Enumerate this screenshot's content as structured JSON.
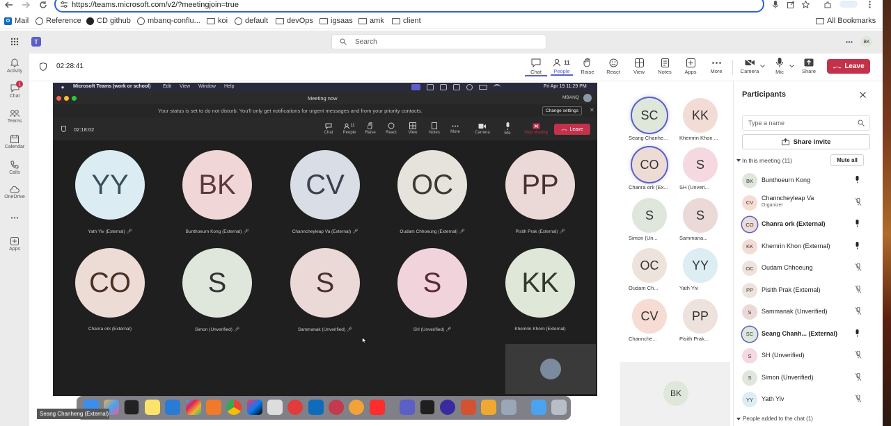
{
  "browser": {
    "url": "https://teams.microsoft.com/v2/?meetingjoin=true",
    "bookmarks": [
      "Mail",
      "Reference",
      "CD github",
      "mbanq-conflu...",
      "koi",
      "default",
      "devOps",
      "igsaas",
      "amk",
      "client"
    ],
    "all_bookmarks": "All Bookmarks"
  },
  "teams": {
    "search_placeholder": "Search",
    "avatar_initials": "BK",
    "rail": [
      {
        "label": "Activity",
        "icon": "bell-icon"
      },
      {
        "label": "Chat",
        "icon": "chat-icon",
        "badge": "1"
      },
      {
        "label": "Teams",
        "icon": "teams-icon"
      },
      {
        "label": "Calendar",
        "icon": "calendar-icon"
      },
      {
        "label": "Calls",
        "icon": "phone-icon"
      },
      {
        "label": "OneDrive",
        "icon": "cloud-icon"
      },
      {
        "label": "Apps",
        "icon": "apps-icon"
      }
    ]
  },
  "meeting": {
    "timer": "02:28:41",
    "tools": [
      {
        "label": "Chat",
        "icon": "chat-icon"
      },
      {
        "label": "People",
        "icon": "people-icon",
        "count": "11"
      },
      {
        "label": "Raise",
        "icon": "hand-icon"
      },
      {
        "label": "React",
        "icon": "smile-icon"
      },
      {
        "label": "View",
        "icon": "grid-icon"
      },
      {
        "label": "Notes",
        "icon": "notes-icon"
      },
      {
        "label": "Apps",
        "icon": "plus-icon"
      },
      {
        "label": "More",
        "icon": "more-icon"
      },
      {
        "label": "Camera",
        "icon": "camera-icon"
      },
      {
        "label": "Mic",
        "icon": "mic-icon"
      },
      {
        "label": "Share",
        "icon": "share-icon"
      }
    ],
    "leave": "Leave"
  },
  "shared": {
    "menubar": [
      "Microsoft Teams (work or school)",
      "Edit",
      "View",
      "Window",
      "Help"
    ],
    "clock": "Fri Apr 19  11:29 PM",
    "window_title": "Meeting now",
    "org": "MBANQ",
    "dnd": "Your status is set to do not disturb. You'll only get notifications for urgent messages and from your priority contacts.",
    "change_settings": "Change settings",
    "timer": "02:18:02",
    "tools": [
      "Chat",
      "People",
      "Raise",
      "React",
      "View",
      "Notes",
      "More",
      "Camera",
      "Mic",
      "Stop sharing"
    ],
    "people_count": "11",
    "leave": "Leave",
    "tiles": [
      {
        "initials": "YY",
        "name": "Yath Yiv (External)",
        "bg": "#dcecf3"
      },
      {
        "initials": "BK",
        "name": "Bunthoeurn Kong (External)",
        "bg": "#f0d6d6"
      },
      {
        "initials": "CV",
        "name": "Channcheyleap Va (External)",
        "bg": "#d8dde6"
      },
      {
        "initials": "OC",
        "name": "Oudam Chhoeung (External)",
        "bg": "#e6e3dc"
      },
      {
        "initials": "PP",
        "name": "Pisith Prak (External)",
        "bg": "#ead9d6"
      },
      {
        "initials": "CO",
        "name": "Chanra ork (External)",
        "bg": "#eddcd6"
      },
      {
        "initials": "S",
        "name": "Simon (Unverified)",
        "bg": "#dfe6dc"
      },
      {
        "initials": "S",
        "name": "Sammanak (Unverified)",
        "bg": "#ead9d6"
      },
      {
        "initials": "S",
        "name": "SH (Unverified)",
        "bg": "#f1d3dc"
      },
      {
        "initials": "KK",
        "name": "Khemrin Khorn (External)",
        "bg": "#dfe8d8"
      }
    ],
    "presenter_label": "Seang Chanheng (External)"
  },
  "gallery": [
    {
      "initials": "SC",
      "name": "Seang Chanhe...",
      "bg": "#dfe7da",
      "ring": true
    },
    {
      "initials": "KK",
      "name": "Khemrin Khon ...",
      "bg": "#f3dcd6",
      "ring": false
    },
    {
      "initials": "CO",
      "name": "Chanra ork (Ex...",
      "bg": "#eddcd6",
      "ring": true
    },
    {
      "initials": "S",
      "name": "SH (Unveri...",
      "bg": "#f5d8e0",
      "ring": false
    },
    {
      "initials": "S",
      "name": "Simon (Un...",
      "bg": "#dfe6dc",
      "ring": false
    },
    {
      "initials": "S",
      "name": "Sammana...",
      "bg": "#ead9d6",
      "ring": false
    },
    {
      "initials": "OC",
      "name": "Oudam Ch...",
      "bg": "#eee3dc",
      "ring": false
    },
    {
      "initials": "YY",
      "name": "Yath Yiv",
      "bg": "#dcedf3",
      "ring": false
    },
    {
      "initials": "CV",
      "name": "Channche...",
      "bg": "#f6dcd2",
      "ring": false
    },
    {
      "initials": "PP",
      "name": "Pisith Prak...",
      "bg": "#eee2dc",
      "ring": false
    }
  ],
  "gallery_bk": "BK",
  "participants": {
    "title": "Participants",
    "search_placeholder": "Type a name",
    "share_invite": "Share invite",
    "in_meeting": "In this meeting (11)",
    "mute_all": "Mute all",
    "list": [
      {
        "initials": "BK",
        "name": "Bunthoeurn Kong",
        "sub": "",
        "bg": "#dfe7da",
        "bold": false,
        "mic": "on"
      },
      {
        "initials": "CV",
        "name": "Channcheyleap Va",
        "sub": "Organizer",
        "bg": "#f6dcd2",
        "bold": false,
        "mic": "off"
      },
      {
        "initials": "CO",
        "name": "Chanra ork (External)",
        "sub": "",
        "bg": "#eddcd6",
        "bold": true,
        "mic": "on"
      },
      {
        "initials": "KK",
        "name": "Khemrin Khon (External)",
        "sub": "",
        "bg": "#f3dcd6",
        "bold": false,
        "mic": "on"
      },
      {
        "initials": "OC",
        "name": "Oudam Chhoeung",
        "sub": "",
        "bg": "#eee3dc",
        "bold": false,
        "mic": "off"
      },
      {
        "initials": "PP",
        "name": "Pisith Prak (External)",
        "sub": "",
        "bg": "#eee2dc",
        "bold": false,
        "mic": "off"
      },
      {
        "initials": "S",
        "name": "Sammanak (Unverified)",
        "sub": "",
        "bg": "#ead9d6",
        "bold": false,
        "mic": "off"
      },
      {
        "initials": "SC",
        "name": "Seang Chanh...  (External)",
        "sub": "",
        "bg": "#dfe7da",
        "bold": true,
        "mic": "on"
      },
      {
        "initials": "S",
        "name": "SH (Unverified)",
        "sub": "",
        "bg": "#f5d8e0",
        "bold": false,
        "mic": "off"
      },
      {
        "initials": "S",
        "name": "Simon (Unverified)",
        "sub": "",
        "bg": "#dfe6dc",
        "bold": false,
        "mic": "off"
      },
      {
        "initials": "YY",
        "name": "Yath Yiv",
        "sub": "",
        "bg": "#dcedf3",
        "bold": false,
        "mic": "off"
      }
    ],
    "added": "People added to the chat (1)"
  }
}
